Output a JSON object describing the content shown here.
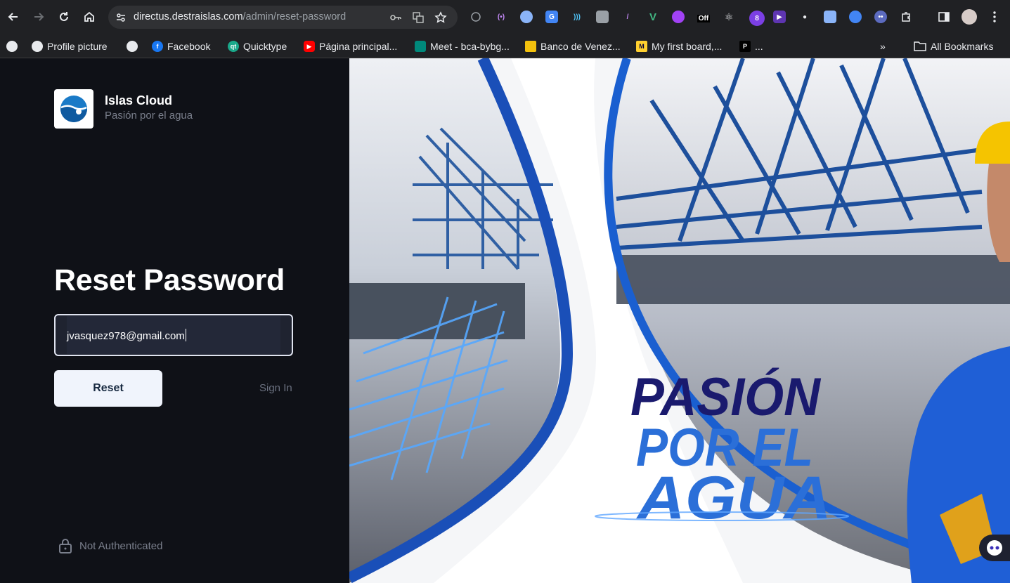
{
  "browser": {
    "url_host": "directus.destraislas.com",
    "url_path": "/admin/reset-password",
    "extension_badges": {
      "off": "Off",
      "count": "8"
    },
    "bookmarks": [
      {
        "label": "Profile picture"
      },
      {
        "label": "Facebook"
      },
      {
        "label": "Quicktype"
      },
      {
        "label": "Página principal..."
      },
      {
        "label": "Meet - bca-bybg..."
      },
      {
        "label": "Banco de Venez..."
      },
      {
        "label": "My first board,..."
      },
      {
        "label": "..."
      }
    ],
    "all_bookmarks": "All Bookmarks"
  },
  "brand": {
    "name": "Islas Cloud",
    "tagline": "Pasión por el agua"
  },
  "form": {
    "title": "Reset Password",
    "email_value": "jvasquez978@gmail.com",
    "reset_label": "Reset",
    "signin_label": "Sign In"
  },
  "status": {
    "auth_text": "Not Authenticated"
  },
  "hero": {
    "line1": "PASIÓN",
    "line2": "POR EL",
    "line3": "AGUA"
  },
  "colors": {
    "accent_blue": "#1a5fd0",
    "navy": "#1a1a6e",
    "hero_blue": "#2b6fd8"
  }
}
